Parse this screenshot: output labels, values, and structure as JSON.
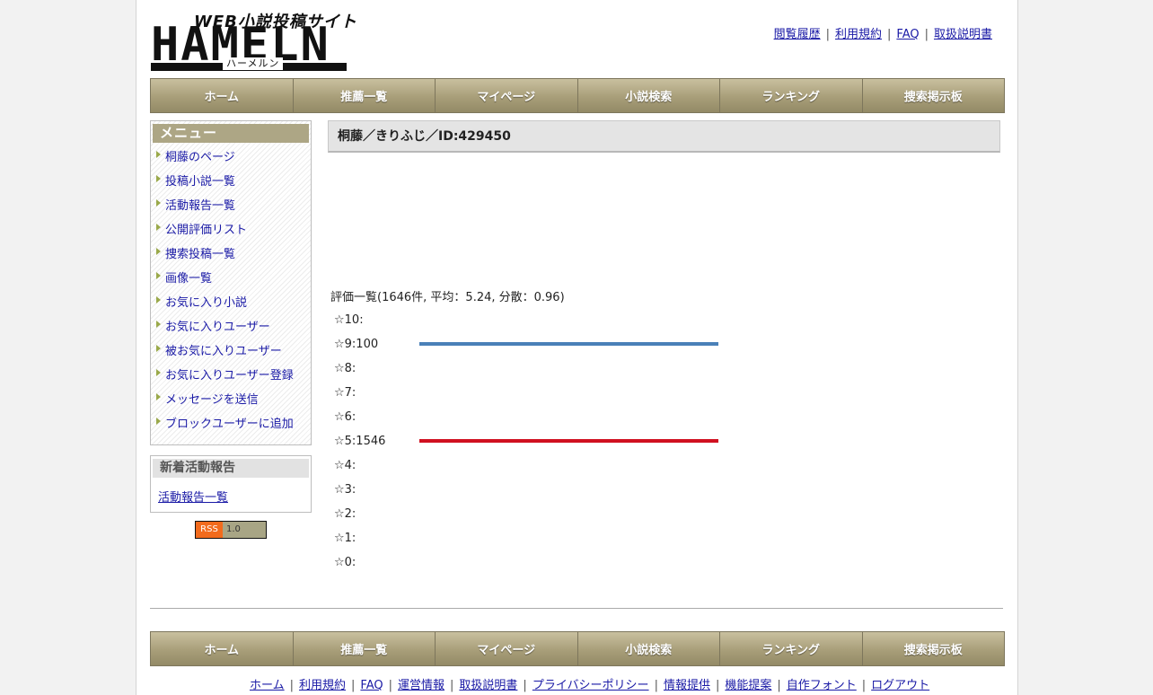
{
  "logo": {
    "tagline": "WEB小説投稿サイト",
    "name": "HAMELN",
    "reading": "ハーメルン"
  },
  "header_links": [
    "閲覧履歴",
    "利用規約",
    "FAQ",
    "取扱説明書"
  ],
  "nav": [
    "ホーム",
    "推薦一覧",
    "マイページ",
    "小説検索",
    "ランキング",
    "捜索掲示板"
  ],
  "sidebar": {
    "menu_title": "メニュー",
    "menu_items": [
      "桐藤のページ",
      "投稿小説一覧",
      "活動報告一覧",
      "公開評価リスト",
      "捜索投稿一覧",
      "画像一覧",
      "お気に入り小説",
      "お気に入りユーザー",
      "被お気に入りユーザー",
      "お気に入りユーザー登録",
      "メッセージを送信",
      "ブロックユーザーに追加"
    ],
    "news_title": "新着活動報告",
    "news_link": "活動報告一覧",
    "rss_left": "RSS",
    "rss_right": "1.0"
  },
  "main": {
    "title": "桐藤／きりふじ／ID:429450",
    "eval_summary": "評価一覧(1646件, 平均：5.24, 分散：0.96)",
    "ratings": [
      {
        "label": "☆10:",
        "count": null,
        "color": ""
      },
      {
        "label": "☆9:100",
        "count": 100,
        "color": "#4a80b8"
      },
      {
        "label": "☆8:",
        "count": null,
        "color": ""
      },
      {
        "label": "☆7:",
        "count": null,
        "color": ""
      },
      {
        "label": "☆6:",
        "count": null,
        "color": ""
      },
      {
        "label": "☆5:1546",
        "count": 1546,
        "color": "#d01020"
      },
      {
        "label": "☆4:",
        "count": null,
        "color": ""
      },
      {
        "label": "☆3:",
        "count": null,
        "color": ""
      },
      {
        "label": "☆2:",
        "count": null,
        "color": ""
      },
      {
        "label": "☆1:",
        "count": null,
        "color": ""
      },
      {
        "label": "☆0:",
        "count": null,
        "color": ""
      }
    ]
  },
  "footer_links": [
    "ホーム",
    "利用規約",
    "FAQ",
    "運営情報",
    "取扱説明書",
    "プライバシーポリシー",
    "情報提供",
    "機能提案",
    "自作フォント",
    "ログアウト"
  ]
}
